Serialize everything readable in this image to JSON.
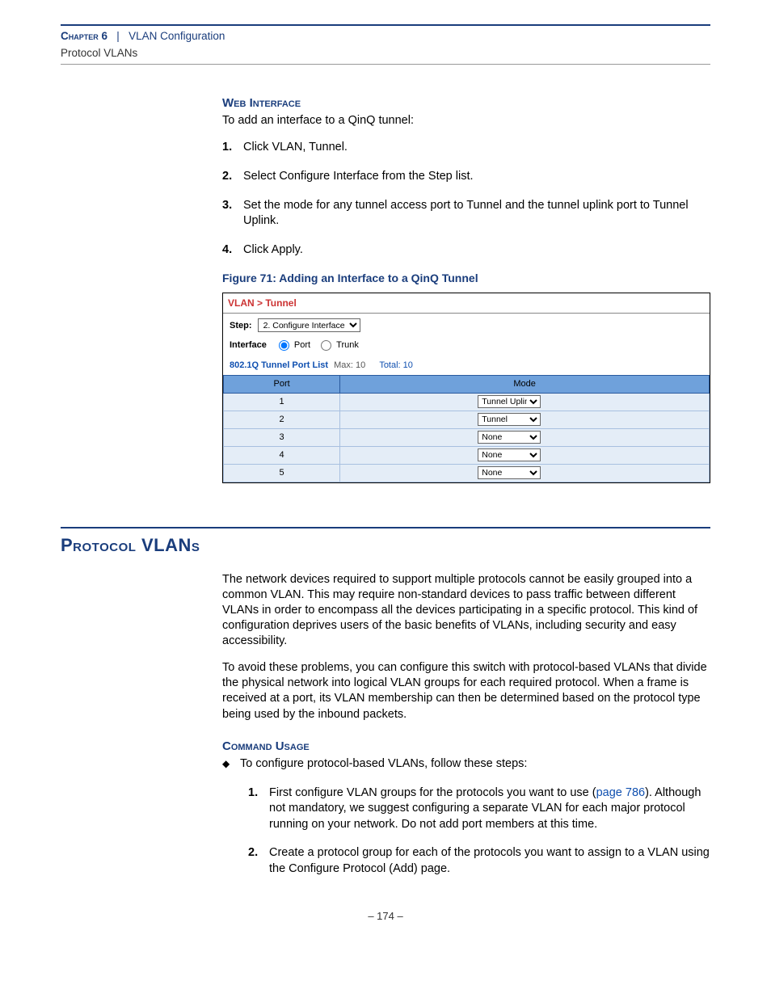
{
  "header": {
    "chapter_label": "Chapter 6",
    "chapter_separator": "|",
    "chapter_title": "VLAN Configuration",
    "subsection": "Protocol VLANs"
  },
  "web_interface": {
    "heading": "Web Interface",
    "intro": "To add an interface to a QinQ tunnel:",
    "steps": [
      {
        "n": "1.",
        "t": "Click VLAN, Tunnel."
      },
      {
        "n": "2.",
        "t": "Select Configure Interface from the Step list."
      },
      {
        "n": "3.",
        "t": "Set the mode for any tunnel access port to Tunnel and the tunnel uplink port to Tunnel Uplink."
      },
      {
        "n": "4.",
        "t": "Click Apply."
      }
    ]
  },
  "figure": {
    "caption": "Figure 71:  Adding an Interface to a QinQ Tunnel",
    "title": "VLAN > Tunnel",
    "step_label": "Step:",
    "step_select": "2. Configure Interface",
    "interface_label": "Interface",
    "radio_port": "Port",
    "radio_trunk": "Trunk",
    "list_title": "802.1Q Tunnel Port List",
    "max_label": "Max: 10",
    "total_label": "Total: 10",
    "col_port": "Port",
    "col_mode": "Mode",
    "rows": [
      {
        "port": "1",
        "mode": "Tunnel Uplink"
      },
      {
        "port": "2",
        "mode": "Tunnel"
      },
      {
        "port": "3",
        "mode": "None"
      },
      {
        "port": "4",
        "mode": "None"
      },
      {
        "port": "5",
        "mode": "None"
      }
    ]
  },
  "protocol_vlans": {
    "heading": "Protocol VLANs",
    "para1": "The network devices required to support multiple protocols cannot be easily grouped into a common VLAN. This may require non-standard devices to pass traffic between different VLANs in order to encompass all the devices participating in a specific protocol. This kind of configuration deprives users of the basic benefits of VLANs, including security and easy accessibility.",
    "para2": "To avoid these problems, you can configure this switch with protocol-based VLANs that divide the physical network into logical VLAN groups for each required protocol. When a frame is received at a port, its VLAN membership can then be determined based on the protocol type being used by the inbound packets.",
    "cmd_heading": "Command Usage",
    "bullet_intro": "To configure protocol-based VLANs, follow these steps:",
    "nested": [
      {
        "n": "1.",
        "pre": "First configure VLAN groups for the protocols you want to use (",
        "link": "page 786",
        "post": "). Although not mandatory, we suggest configuring a separate VLAN for each major protocol running on your network. Do not add port members at this time."
      },
      {
        "n": "2.",
        "t": "Create a protocol group for each of the protocols you want to assign to a VLAN using the Configure Protocol (Add) page."
      }
    ]
  },
  "footer": {
    "page": "–  174  –"
  }
}
